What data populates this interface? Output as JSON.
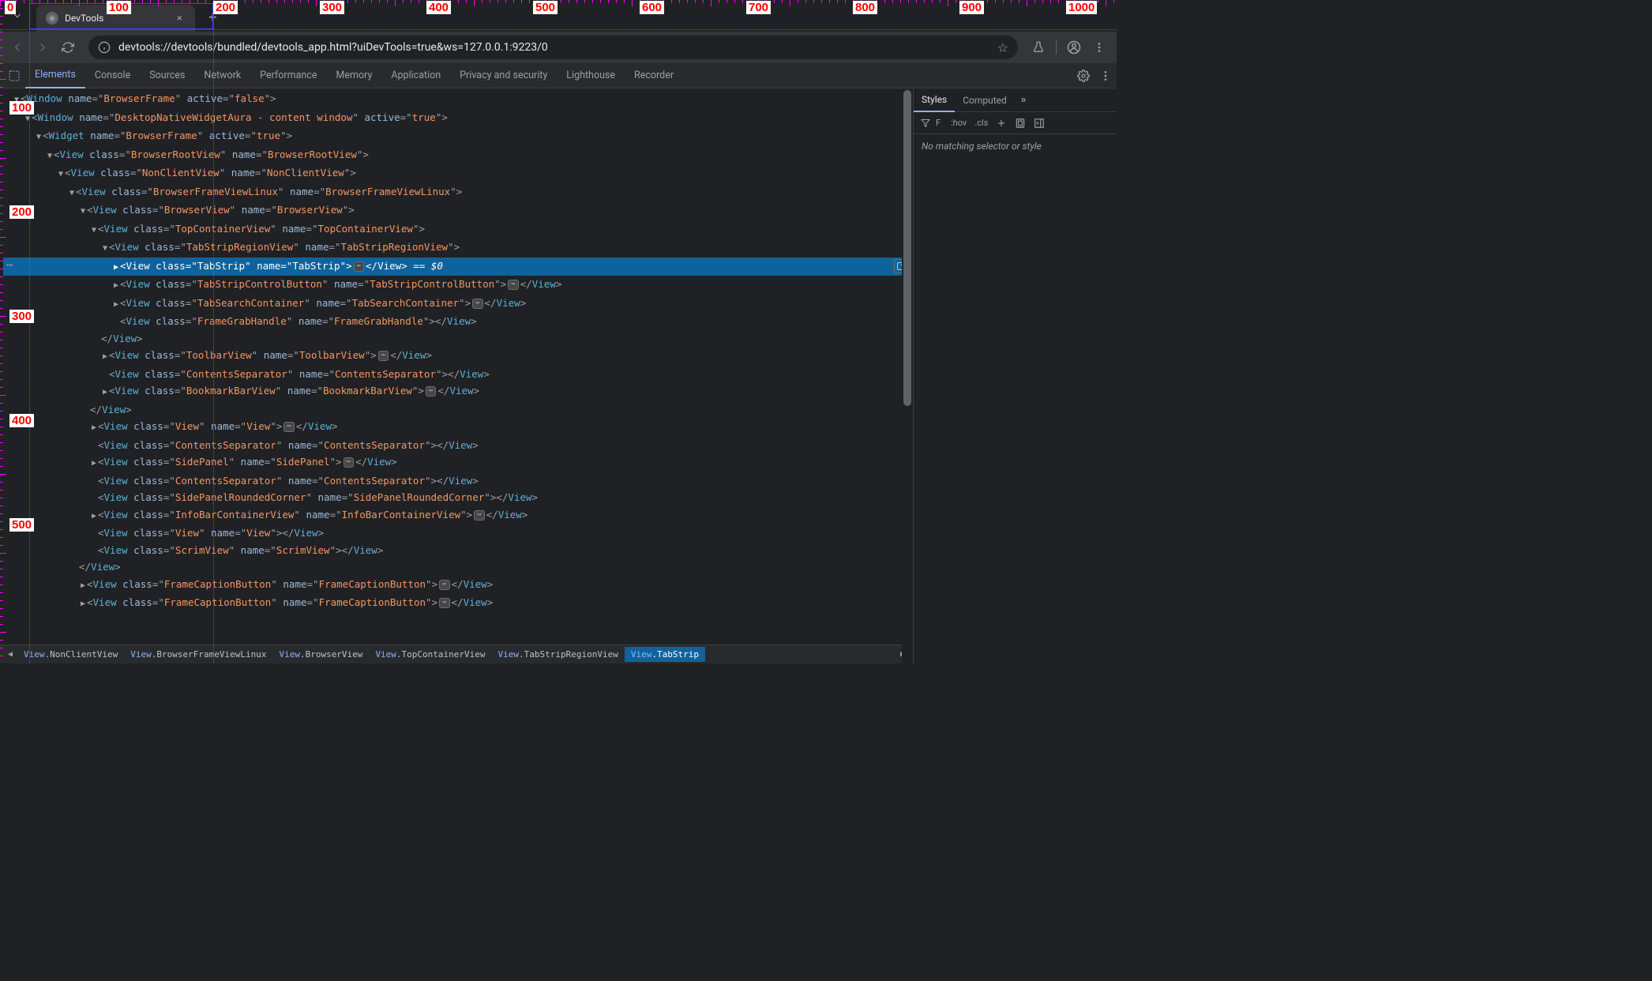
{
  "browser": {
    "tab_title": "DevTools",
    "url": "devtools://devtools/bundled/devtools_app.html?uiDevTools=true&ws=127.0.0.1:9223/0",
    "new_tab": "+",
    "close_tab": "×"
  },
  "devtools": {
    "tabs": [
      "Elements",
      "Console",
      "Sources",
      "Network",
      "Performance",
      "Memory",
      "Application",
      "Privacy and security",
      "Lighthouse",
      "Recorder"
    ],
    "active_tab": "Elements"
  },
  "tree": [
    {
      "indent": 0,
      "arrow": "▼",
      "tag": "Window",
      "attrs": [
        [
          "name",
          "BrowserFrame"
        ],
        [
          "active",
          "false"
        ]
      ],
      "open": true
    },
    {
      "indent": 1,
      "arrow": "▼",
      "tag": "Window",
      "attrs": [
        [
          "name",
          "DesktopNativeWidgetAura - content window"
        ],
        [
          "active",
          "true"
        ]
      ],
      "open": true
    },
    {
      "indent": 2,
      "arrow": "▼",
      "tag": "Widget",
      "attrs": [
        [
          "name",
          "BrowserFrame"
        ],
        [
          "active",
          "true"
        ]
      ],
      "open": true
    },
    {
      "indent": 3,
      "arrow": "▼",
      "tag": "View",
      "attrs": [
        [
          "class",
          "BrowserRootView"
        ],
        [
          "name",
          "BrowserRootView"
        ]
      ],
      "open": true
    },
    {
      "indent": 4,
      "arrow": "▼",
      "tag": "View",
      "attrs": [
        [
          "class",
          "NonClientView"
        ],
        [
          "name",
          "NonClientView"
        ]
      ],
      "open": true
    },
    {
      "indent": 5,
      "arrow": "▼",
      "tag": "View",
      "attrs": [
        [
          "class",
          "BrowserFrameViewLinux"
        ],
        [
          "name",
          "BrowserFrameViewLinux"
        ]
      ],
      "open": true
    },
    {
      "indent": 6,
      "arrow": "▼",
      "tag": "View",
      "attrs": [
        [
          "class",
          "BrowserView"
        ],
        [
          "name",
          "BrowserView"
        ]
      ],
      "open": true
    },
    {
      "indent": 7,
      "arrow": "▼",
      "tag": "View",
      "attrs": [
        [
          "class",
          "TopContainerView"
        ],
        [
          "name",
          "TopContainerView"
        ]
      ],
      "open": true
    },
    {
      "indent": 8,
      "arrow": "▼",
      "tag": "View",
      "attrs": [
        [
          "class",
          "TabStripRegionView"
        ],
        [
          "name",
          "TabStripRegionView"
        ]
      ],
      "open": true
    },
    {
      "indent": 9,
      "arrow": "▶",
      "tag": "View",
      "attrs": [
        [
          "class",
          "TabStrip"
        ],
        [
          "name",
          "TabStrip"
        ]
      ],
      "ell": true,
      "close": true,
      "selected": true,
      "selmark": " == $0"
    },
    {
      "indent": 9,
      "arrow": "▶",
      "tag": "View",
      "attrs": [
        [
          "class",
          "TabStripControlButton"
        ],
        [
          "name",
          "TabStripControlButton"
        ]
      ],
      "ell": true,
      "close": true
    },
    {
      "indent": 9,
      "arrow": "▶",
      "tag": "View",
      "attrs": [
        [
          "class",
          "TabSearchContainer"
        ],
        [
          "name",
          "TabSearchContainer"
        ]
      ],
      "ell": true,
      "close": true
    },
    {
      "indent": 9,
      "arrow": "",
      "tag": "View",
      "attrs": [
        [
          "class",
          "FrameGrabHandle"
        ],
        [
          "name",
          "FrameGrabHandle"
        ]
      ],
      "close": true
    },
    {
      "indent": 8,
      "closing": "View"
    },
    {
      "indent": 8,
      "arrow": "▶",
      "tag": "View",
      "attrs": [
        [
          "class",
          "ToolbarView"
        ],
        [
          "name",
          "ToolbarView"
        ]
      ],
      "ell": true,
      "close": true
    },
    {
      "indent": 8,
      "arrow": "",
      "tag": "View",
      "attrs": [
        [
          "class",
          "ContentsSeparator"
        ],
        [
          "name",
          "ContentsSeparator"
        ]
      ],
      "close": true
    },
    {
      "indent": 8,
      "arrow": "▶",
      "tag": "View",
      "attrs": [
        [
          "class",
          "BookmarkBarView"
        ],
        [
          "name",
          "BookmarkBarView"
        ]
      ],
      "ell": true,
      "close": true
    },
    {
      "indent": 7,
      "closing": "View"
    },
    {
      "indent": 7,
      "arrow": "▶",
      "tag": "View",
      "attrs": [
        [
          "class",
          "View"
        ],
        [
          "name",
          "View"
        ]
      ],
      "ell": true,
      "close": true
    },
    {
      "indent": 7,
      "arrow": "",
      "tag": "View",
      "attrs": [
        [
          "class",
          "ContentsSeparator"
        ],
        [
          "name",
          "ContentsSeparator"
        ]
      ],
      "close": true
    },
    {
      "indent": 7,
      "arrow": "▶",
      "tag": "View",
      "attrs": [
        [
          "class",
          "SidePanel"
        ],
        [
          "name",
          "SidePanel"
        ]
      ],
      "ell": true,
      "close": true
    },
    {
      "indent": 7,
      "arrow": "",
      "tag": "View",
      "attrs": [
        [
          "class",
          "ContentsSeparator"
        ],
        [
          "name",
          "ContentsSeparator"
        ]
      ],
      "close": true
    },
    {
      "indent": 7,
      "arrow": "",
      "tag": "View",
      "attrs": [
        [
          "class",
          "SidePanelRoundedCorner"
        ],
        [
          "name",
          "SidePanelRoundedCorner"
        ]
      ],
      "close": true
    },
    {
      "indent": 7,
      "arrow": "▶",
      "tag": "View",
      "attrs": [
        [
          "class",
          "InfoBarContainerView"
        ],
        [
          "name",
          "InfoBarContainerView"
        ]
      ],
      "ell": true,
      "close": true
    },
    {
      "indent": 7,
      "arrow": "",
      "tag": "View",
      "attrs": [
        [
          "class",
          "View"
        ],
        [
          "name",
          "View"
        ]
      ],
      "close": true
    },
    {
      "indent": 7,
      "arrow": "",
      "tag": "View",
      "attrs": [
        [
          "class",
          "ScrimView"
        ],
        [
          "name",
          "ScrimView"
        ]
      ],
      "close": true
    },
    {
      "indent": 6,
      "closing": "View"
    },
    {
      "indent": 6,
      "arrow": "▶",
      "tag": "View",
      "attrs": [
        [
          "class",
          "FrameCaptionButton"
        ],
        [
          "name",
          "FrameCaptionButton"
        ]
      ],
      "ell": true,
      "close": true
    },
    {
      "indent": 6,
      "arrow": "▶",
      "tag": "View",
      "attrs": [
        [
          "class",
          "FrameCaptionButton"
        ],
        [
          "name",
          "FrameCaptionButton"
        ]
      ],
      "ell": true,
      "close": true
    }
  ],
  "breadcrumb": [
    {
      "v": "View",
      "n": "NonClientView"
    },
    {
      "v": "View",
      "n": "BrowserFrameViewLinux"
    },
    {
      "v": "View",
      "n": "BrowserView"
    },
    {
      "v": "View",
      "n": "TopContainerView"
    },
    {
      "v": "View",
      "n": "TabStripRegionView"
    },
    {
      "v": "View",
      "n": "TabStrip",
      "active": true
    }
  ],
  "sidebar": {
    "tabs": [
      "Styles",
      "Computed"
    ],
    "active_tab": "Styles",
    "more": "»",
    "filter_placeholder": "F",
    "hov": ":hov",
    "cls": ".cls",
    "empty": "No matching selector or style"
  },
  "ruler": {
    "x": [
      "0",
      "100",
      "200",
      "300",
      "400",
      "500",
      "600",
      "700",
      "800",
      "900",
      "1000"
    ],
    "y": [
      "100",
      "200",
      "300",
      "400",
      "500"
    ]
  }
}
